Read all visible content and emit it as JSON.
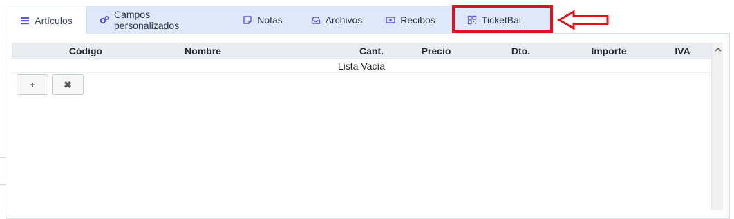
{
  "tabs": [
    {
      "label": "Artículos",
      "icon": "list-icon",
      "active": true
    },
    {
      "label": "Campos personalizados",
      "icon": "gears-icon"
    },
    {
      "label": "Notas",
      "icon": "sticky-note-icon"
    },
    {
      "label": "Archivos",
      "icon": "inbox-icon"
    },
    {
      "label": "Recibos",
      "icon": "money-bill-icon"
    },
    {
      "label": "TicketBai",
      "icon": "qrcode-icon"
    }
  ],
  "grid": {
    "columns": [
      "Código",
      "Nombre",
      "Cant.",
      "Precio",
      "Dto.",
      "Importe",
      "IVA"
    ],
    "empty_text": "Lista Vacía"
  },
  "buttons": {
    "add_label": "+",
    "delete_label": "✖"
  },
  "colors": {
    "accent": "#5b57d6",
    "highlight": "#e0121b",
    "tab_bar": "#dde9f9"
  }
}
